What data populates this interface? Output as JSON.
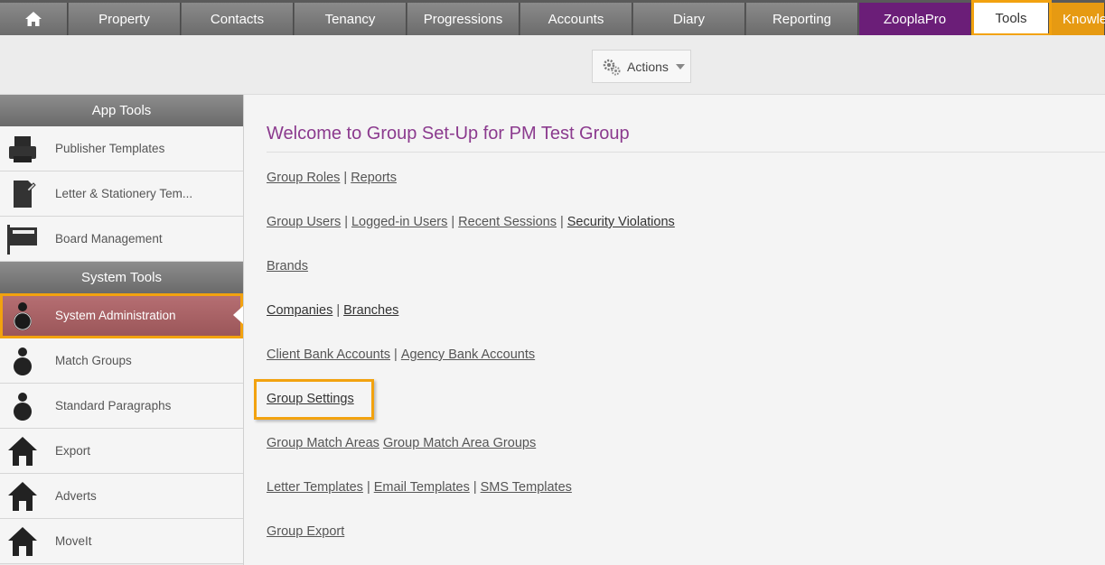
{
  "topnav": {
    "tabs": [
      {
        "label": "",
        "name": "tab-home"
      },
      {
        "label": "Property",
        "name": "tab-property"
      },
      {
        "label": "Contacts",
        "name": "tab-contacts"
      },
      {
        "label": "Tenancy",
        "name": "tab-tenancy"
      },
      {
        "label": "Progressions",
        "name": "tab-progressions"
      },
      {
        "label": "Accounts",
        "name": "tab-accounts"
      },
      {
        "label": "Diary",
        "name": "tab-diary"
      },
      {
        "label": "Reporting",
        "name": "tab-reporting"
      },
      {
        "label": "ZooplaPro",
        "name": "tab-zooplapro"
      },
      {
        "label": "Tools",
        "name": "tab-tools"
      },
      {
        "label": "Knowle",
        "name": "tab-knowledge"
      }
    ]
  },
  "actionbar": {
    "actions_label": "Actions"
  },
  "sidebar": {
    "app_tools_title": "App Tools",
    "app_tools": [
      {
        "label": "Publisher Templates"
      },
      {
        "label": "Letter & Stationery Tem..."
      },
      {
        "label": "Board Management"
      }
    ],
    "system_tools_title": "System Tools",
    "system_tools": [
      {
        "label": "System Administration"
      },
      {
        "label": "Match Groups"
      },
      {
        "label": "Standard Paragraphs"
      },
      {
        "label": "Export"
      },
      {
        "label": "Adverts"
      },
      {
        "label": "MoveIt"
      }
    ]
  },
  "main": {
    "welcome": "Welcome to Group Set-Up for PM Test Group",
    "rows": [
      {
        "links": [
          "Group Roles",
          "Reports"
        ],
        "sep": [
          "|"
        ]
      },
      {
        "links": [
          "Group Users",
          "Logged-in Users",
          "Recent Sessions",
          "Security Violations"
        ],
        "sep": [
          "|",
          "|",
          "|"
        ]
      },
      {
        "links": [
          "Brands"
        ]
      },
      {
        "links": [
          "Companies",
          "Branches"
        ],
        "sep": [
          "|"
        ]
      },
      {
        "links": [
          "Client Bank Accounts",
          "Agency Bank Accounts"
        ],
        "sep": [
          "|"
        ]
      },
      {
        "links": [
          "Group Settings"
        ]
      },
      {
        "links": [
          "Group Match Areas",
          "Group Match Area Groups"
        ]
      },
      {
        "links": [
          "Letter Templates",
          "Email Templates",
          "SMS Templates"
        ],
        "sep": [
          "|",
          "|"
        ]
      },
      {
        "links": [
          "Group Export"
        ]
      }
    ]
  },
  "colors": {
    "accent_highlight": "#f2a20f",
    "zoopla": "#6b1e78",
    "knowledge": "#e69a12",
    "welcome_text": "#8b3a8e",
    "active_item": "#a85f63"
  }
}
